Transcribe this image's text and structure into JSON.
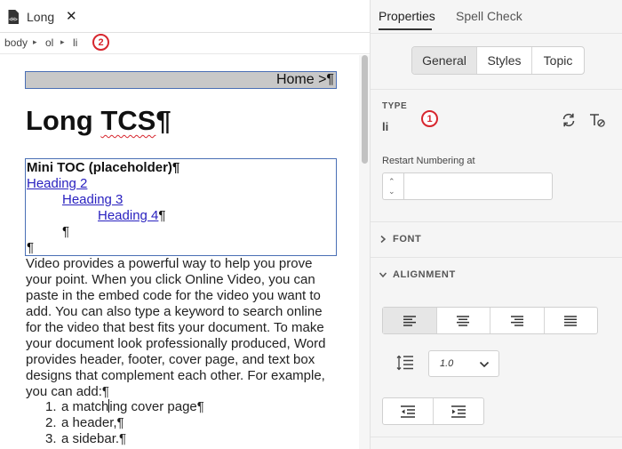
{
  "editor": {
    "tab_title": "Long",
    "tab_close": "✕",
    "breadcrumb": [
      "body",
      "ol",
      "li"
    ],
    "breadcrumb_sep": "▸",
    "callout_breadcrumb": "2"
  },
  "document": {
    "home_link": "Home >¶",
    "title": "Long TCS¶",
    "title_plain": "Long ",
    "title_squiggle": "TCS",
    "title_mark": "¶",
    "mini_toc": {
      "title": "Mini TOC (placeholder)¶",
      "h2": "Heading 2",
      "h3": "Heading 3",
      "h4": "Heading 4",
      "mark": "¶"
    },
    "paragraph": "Video provides a powerful way to help you prove your point. When you click Online Video, you can paste in the embed code for the video you want to add. You can also type a keyword to search online for the video that best fits your document. To make your document look professionally produced, Word provides header, footer, cover page, and text box designs that complement each other. For example, you can add:¶",
    "list": [
      {
        "num": "1.",
        "before_caret": "a match",
        "after_caret": "ing cover page¶"
      },
      {
        "num": "2.",
        "text": "a header,¶"
      },
      {
        "num": "3.",
        "text": "a sidebar.¶"
      }
    ]
  },
  "panel": {
    "tabs": [
      "Properties",
      "Spell Check"
    ],
    "segments": [
      "General",
      "Styles",
      "Topic"
    ],
    "type_label": "TYPE",
    "type_value": "li",
    "callout_type": "1",
    "restart_label": "Restart Numbering at",
    "restart_value": "",
    "font_section": "FONT",
    "alignment_section": "ALIGNMENT",
    "line_spacing": "1.0"
  }
}
